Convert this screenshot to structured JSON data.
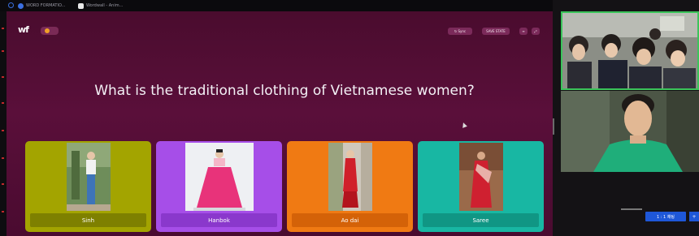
{
  "browser": {
    "tabs": [
      {
        "label": "WORD FORMATIO...",
        "icon": "globe-icon",
        "color": "#3b6fe0"
      },
      {
        "label": "Wordwall - Anim...",
        "icon": "page-icon",
        "color": "#e8e8e8"
      }
    ]
  },
  "quiz": {
    "logo": "wf",
    "toolbar": [
      "↻ Sync",
      "SAVE STATE",
      "≡",
      "⤢"
    ],
    "question": "What is the traditional clothing of Vietnamese women?",
    "answers": [
      {
        "label": "Sinh",
        "card_color": "#a3a400",
        "label_color": "#7e8000"
      },
      {
        "label": "Hanbok",
        "card_color": "#a64ee8",
        "label_color": "#8a38cc"
      },
      {
        "label": "Ao dai",
        "card_color": "#f07a13",
        "label_color": "#d46208"
      },
      {
        "label": "Saree",
        "card_color": "#18b7a3",
        "label_color": "#109684"
      }
    ]
  },
  "video_panel": {
    "active_speaker_color": "#3bc45a",
    "button_label": "1 : 1 채팅",
    "button_label_2": "+"
  }
}
